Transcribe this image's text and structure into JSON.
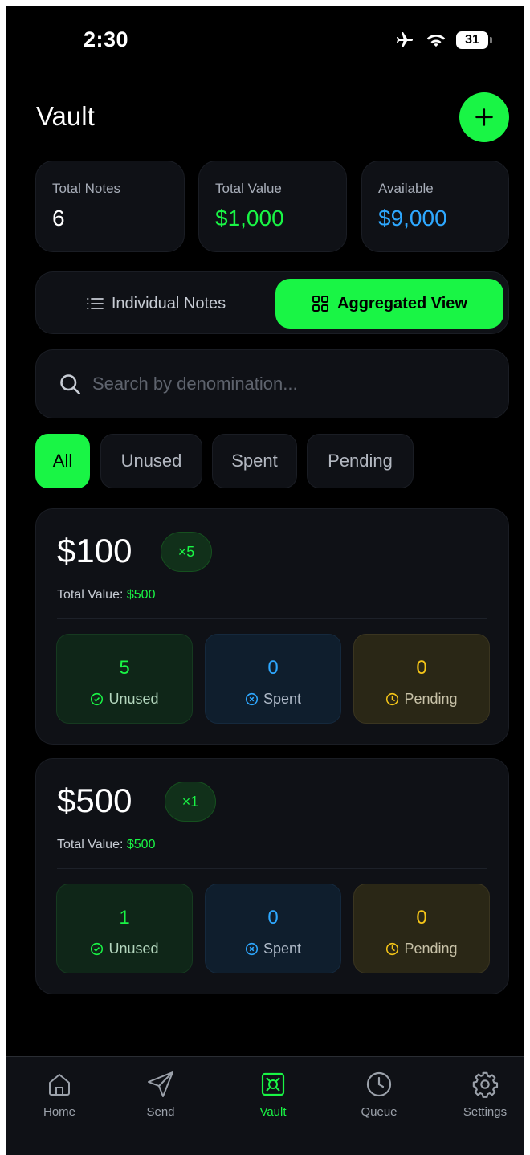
{
  "status_bar": {
    "time": "2:30",
    "battery": "31"
  },
  "header": {
    "title": "Vault"
  },
  "stats": [
    {
      "label": "Total Notes",
      "value": "6",
      "color": "#ffffff"
    },
    {
      "label": "Total Value",
      "value": "$1,000",
      "color": "#19f545"
    },
    {
      "label": "Available",
      "value": "$9,000",
      "color": "#2ea8ff"
    }
  ],
  "view_toggle": {
    "individual_label": "Individual Notes",
    "aggregated_label": "Aggregated View",
    "selected": "aggregated"
  },
  "search": {
    "placeholder": "Search by denomination...",
    "value": ""
  },
  "filters": {
    "items": [
      "All",
      "Unused",
      "Spent",
      "Pending"
    ],
    "selected": "All"
  },
  "denominations": [
    {
      "amount": "$100",
      "count": "×5",
      "total_label": "Total Value:",
      "total_value": "$500",
      "unused": "5",
      "spent": "0",
      "pending": "0",
      "unused_label": "Unused",
      "spent_label": "Spent",
      "pending_label": "Pending"
    },
    {
      "amount": "$500",
      "count": "×1",
      "total_label": "Total Value:",
      "total_value": "$500",
      "unused": "1",
      "spent": "0",
      "pending": "0",
      "unused_label": "Unused",
      "spent_label": "Spent",
      "pending_label": "Pending"
    }
  ],
  "nav": {
    "items": [
      {
        "label": "Home",
        "icon": "home-icon"
      },
      {
        "label": "Send",
        "icon": "send-icon"
      },
      {
        "label": "Vault",
        "icon": "vault-icon"
      },
      {
        "label": "Queue",
        "icon": "clock-icon"
      },
      {
        "label": "Settings",
        "icon": "gear-icon"
      }
    ],
    "active": "Vault"
  },
  "colors": {
    "accent": "#19f545",
    "blue": "#2ea8ff",
    "yellow": "#f5c518",
    "background": "#000000",
    "card": "#0f1116"
  }
}
